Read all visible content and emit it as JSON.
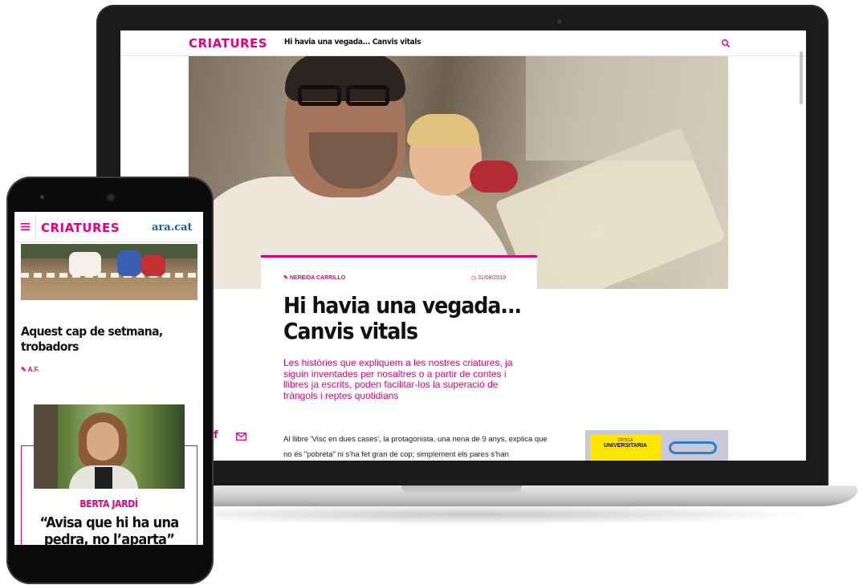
{
  "desktop": {
    "logo": "CRIATURES",
    "header_title": "Hi havia una vegada... Canvis vitals",
    "article": {
      "author": "NEREIDA CARRILLO",
      "date": "31/08/2019",
      "title": "Hi havia una vegada... Canvis vitals",
      "lead": "Les històries que expliquem a les nostres criatures, ja siguin inventades per nosaltres o a partir de contes i llibres ja escrits, poden facilitar-los la superació de tràngols i reptes quotidians",
      "body": "Al llibre 'Visc en dues cases', la protagonista, una nena de 9 anys, explica que no és \"pobreta\" ni s'ha fet gran de cop; simplement els pares s'han"
    },
    "ad": {
      "small_text": "ÒPTICA",
      "big_text": "UNIVERSITARIA"
    },
    "share": {
      "facebook_icon": "facebook-icon",
      "mail_icon": "mail-icon"
    }
  },
  "mobile": {
    "logo": "CRIATURES",
    "brand": "ara.cat",
    "article1": {
      "title": "Aquest cap de setmana, trobadors",
      "author": "A.F."
    },
    "opinion": {
      "author": "BERTA JARDÍ",
      "quote": "“Avisa que hi ha una pedra, no l’aparta”"
    }
  },
  "colors": {
    "accent": "#e6007e",
    "brand_blue": "#1e5ea8",
    "device_body": "#1b1b1d"
  }
}
